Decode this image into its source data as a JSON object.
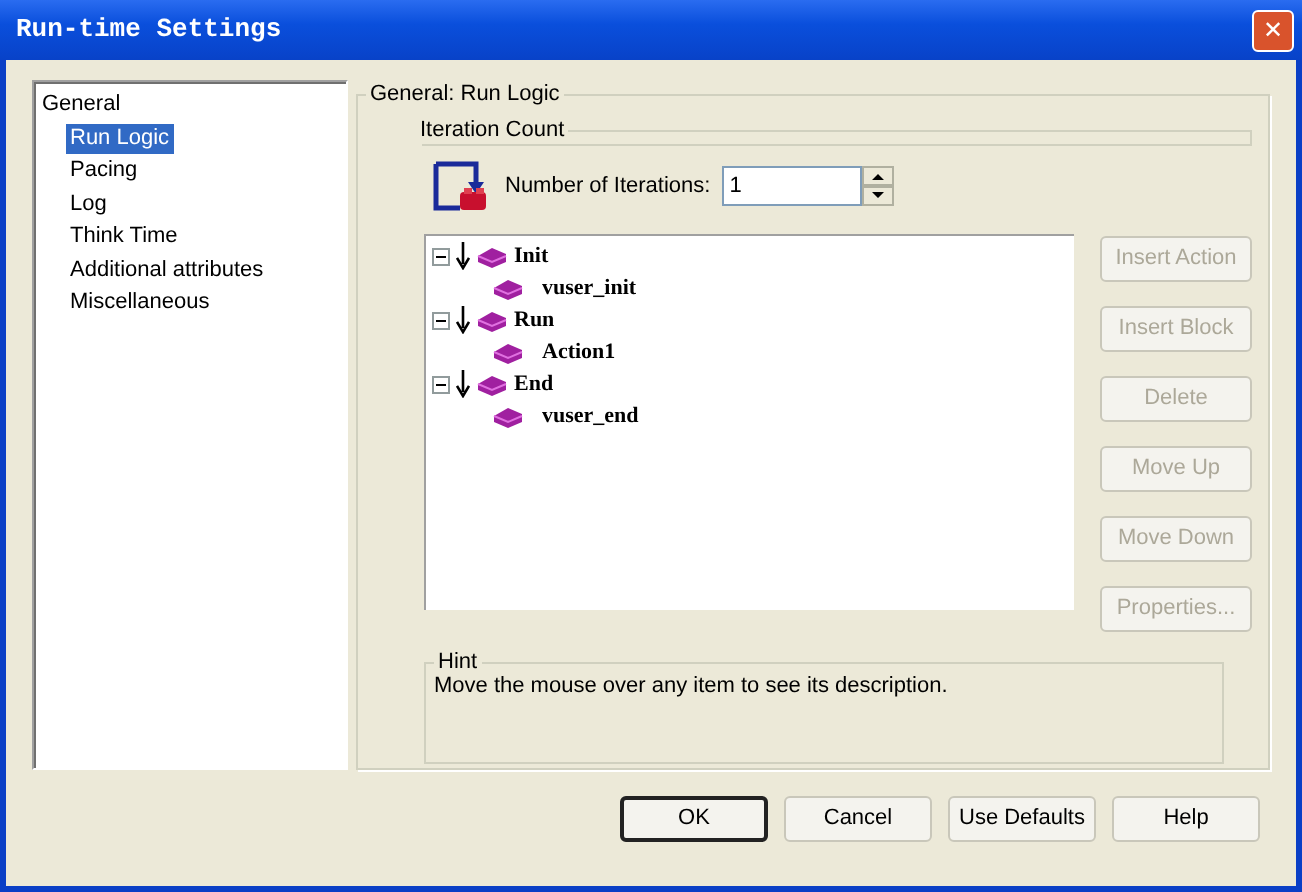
{
  "window": {
    "title": "Run-time Settings",
    "close_label": "✕"
  },
  "settings_tree": [
    {
      "label": "General",
      "selected": false,
      "children": [
        {
          "label": "Run Logic",
          "selected": true
        },
        {
          "label": "Pacing",
          "selected": false
        },
        {
          "label": "Log",
          "selected": false
        },
        {
          "label": "Think Time",
          "selected": false
        },
        {
          "label": "Additional attributes",
          "selected": false
        },
        {
          "label": "Miscellaneous",
          "selected": false
        }
      ]
    }
  ],
  "section_title": "General: Run Logic",
  "iteration_count": {
    "title": "Iteration Count",
    "label": "Number of Iterations:",
    "value": "1"
  },
  "logic_tree": [
    {
      "label": "Init",
      "expanded": true,
      "children": [
        {
          "label": "vuser_init"
        }
      ]
    },
    {
      "label": "Run",
      "expanded": true,
      "children": [
        {
          "label": "Action1"
        }
      ]
    },
    {
      "label": "End",
      "expanded": true,
      "children": [
        {
          "label": "vuser_end"
        }
      ]
    }
  ],
  "side_buttons": [
    {
      "label": "Insert Action",
      "disabled": true
    },
    {
      "label": "Insert Block",
      "disabled": true
    },
    {
      "label": "Delete",
      "disabled": true
    },
    {
      "label": "Move Up",
      "disabled": true
    },
    {
      "label": "Move Down",
      "disabled": true
    },
    {
      "label": "Properties...",
      "disabled": true
    }
  ],
  "hint": {
    "title": "Hint",
    "text": "Move the mouse over any item to see its description."
  },
  "footer_buttons": [
    {
      "label": "OK",
      "default": true
    },
    {
      "label": "Cancel",
      "default": false
    },
    {
      "label": "Use Defaults",
      "default": false
    },
    {
      "label": "Help",
      "default": false
    }
  ]
}
